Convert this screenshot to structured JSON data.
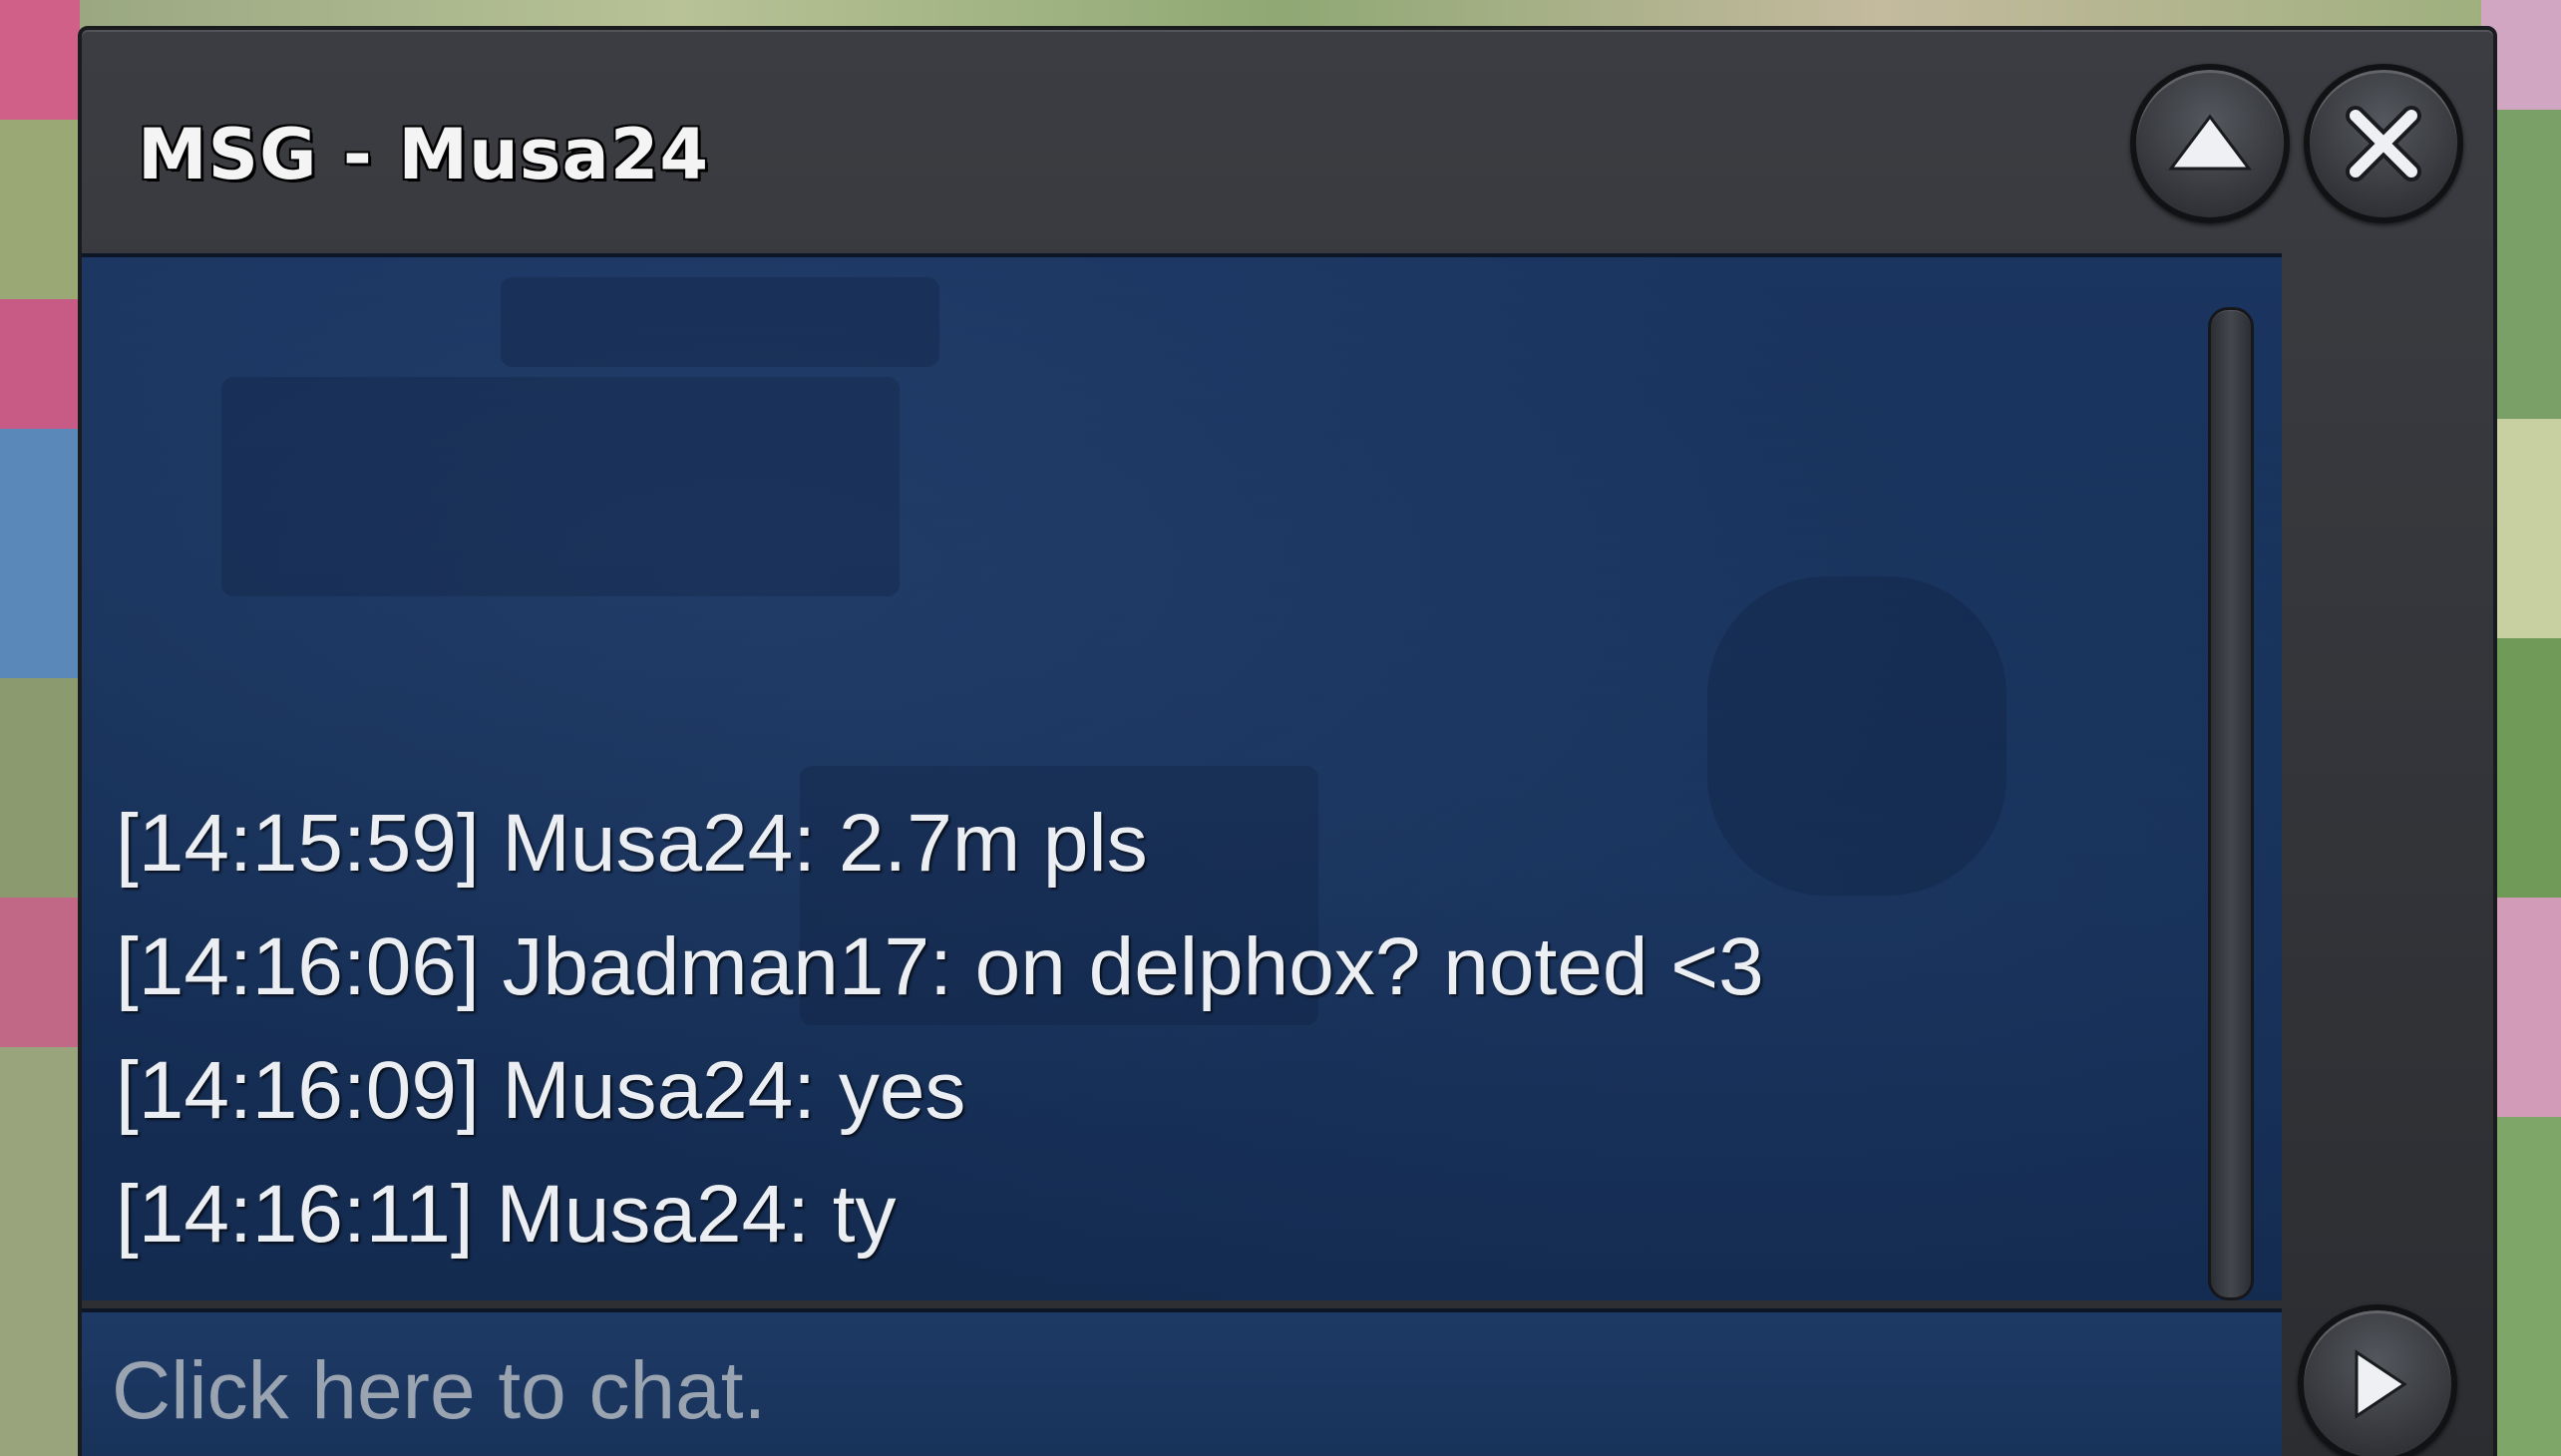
{
  "window": {
    "title": "MSG - Musa24"
  },
  "icons": {
    "minimize": "chevron-up-icon",
    "close": "close-icon",
    "send": "play-arrow-icon"
  },
  "messages": [
    "[14:15:59] Musa24: 2.7m pls",
    "[14:16:06] Jbadman17: on delphox? noted <3",
    "[14:16:09] Musa24: yes",
    "[14:16:11] Musa24: ty"
  ],
  "input": {
    "placeholder": "Click here to chat."
  },
  "colors": {
    "window_frame": "#2e3035",
    "chat_background": "#163058",
    "text": "#ebeef3"
  }
}
